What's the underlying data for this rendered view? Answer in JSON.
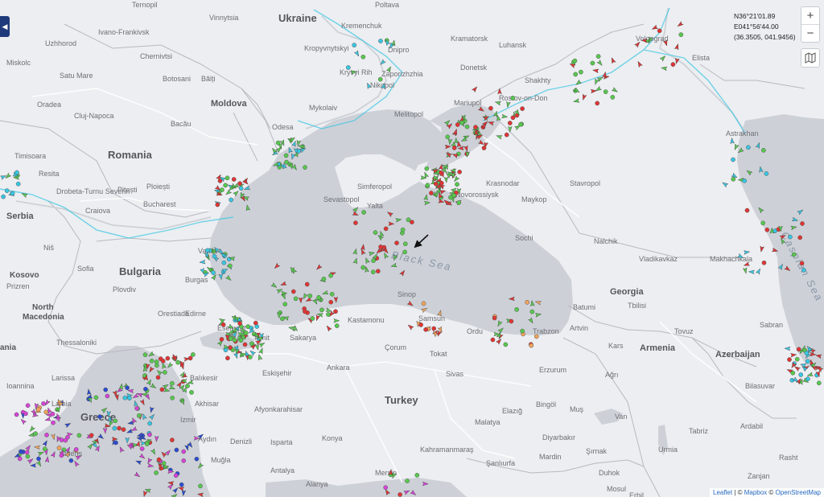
{
  "coords": {
    "lat": "N36°21'01.89",
    "lon": "E041°56'44.00",
    "decimal": "(36.3505, 041.9456)"
  },
  "controls": {
    "zoom_in": "+",
    "zoom_out": "−",
    "sidebar_toggle": "◀"
  },
  "attribution": {
    "leaflet": "Leaflet",
    "separator": " | © ",
    "mapbox": "Mapbox",
    "osm": "OpenStreetMap"
  },
  "labels": {
    "countries": [
      {
        "text": "Ukraine"
      },
      {
        "text": "Romania"
      },
      {
        "text": "Moldova"
      },
      {
        "text": "Serbia"
      },
      {
        "text": "Bulgaria"
      },
      {
        "text": "Kosovo"
      },
      {
        "text": "North"
      },
      {
        "text": "Macedonia"
      },
      {
        "text": "Greece"
      },
      {
        "text": "Turkey"
      },
      {
        "text": "Georgia"
      },
      {
        "text": "Armenia"
      },
      {
        "text": "Azerbaijan"
      },
      {
        "text": "ania"
      }
    ],
    "seas": [
      {
        "text": "Black Sea"
      },
      {
        "text": "Caspian Sea"
      }
    ],
    "cities": [
      {
        "text": "Ternopil"
      },
      {
        "text": "Vinnytsia"
      },
      {
        "text": "Poltava"
      },
      {
        "text": "Kremenchuk"
      },
      {
        "text": "Uzhhorod"
      },
      {
        "text": "Ivano-Frankivsk"
      },
      {
        "text": "Kramatorsk"
      },
      {
        "text": "Luhansk"
      },
      {
        "text": "Kropyvnytskyi"
      },
      {
        "text": "Dnipro"
      },
      {
        "text": "Volgograd"
      },
      {
        "text": "Miskolc"
      },
      {
        "text": "Chernivtsi"
      },
      {
        "text": "Kryvyi Rih"
      },
      {
        "text": "Zaporizhzhia"
      },
      {
        "text": "Donetsk"
      },
      {
        "text": "Elista"
      },
      {
        "text": "Satu Mare"
      },
      {
        "text": "Botosani"
      },
      {
        "text": "Bălți"
      },
      {
        "text": "Nikopol"
      },
      {
        "text": "Shakhty"
      },
      {
        "text": "Oradea"
      },
      {
        "text": "Cluj-Napoca"
      },
      {
        "text": "Mykolaiv"
      },
      {
        "text": "Mariupol"
      },
      {
        "text": "Rostov-on-Don"
      },
      {
        "text": "Melitopol"
      },
      {
        "text": "Bacău"
      },
      {
        "text": "Odesa"
      },
      {
        "text": "Astrakhan"
      },
      {
        "text": "Timisoara"
      },
      {
        "text": "Resita"
      },
      {
        "text": "Simferopol"
      },
      {
        "text": "Krasnodar"
      },
      {
        "text": "Stavropol"
      },
      {
        "text": "Drobeta-Turnu Severin"
      },
      {
        "text": "Pitești"
      },
      {
        "text": "Ploiești"
      },
      {
        "text": "Sevastopol"
      },
      {
        "text": "Yalta"
      },
      {
        "text": "Novorossiysk"
      },
      {
        "text": "Maykop"
      },
      {
        "text": "Craiova"
      },
      {
        "text": "Bucharest"
      },
      {
        "text": "Sochi"
      },
      {
        "text": "Niš"
      },
      {
        "text": "Nalchik"
      },
      {
        "text": "Varna"
      },
      {
        "text": "Vladikavkaz"
      },
      {
        "text": "Makhachkala"
      },
      {
        "text": "Sofia"
      },
      {
        "text": "Burgas"
      },
      {
        "text": "Prizren"
      },
      {
        "text": "Plovdiv"
      },
      {
        "text": "Tbilisi"
      },
      {
        "text": "Batumi"
      },
      {
        "text": "Sinop"
      },
      {
        "text": "Kastamonu"
      },
      {
        "text": "Samsun"
      },
      {
        "text": "Ordu"
      },
      {
        "text": "Trabzon"
      },
      {
        "text": "Artvin"
      },
      {
        "text": "Edirne"
      },
      {
        "text": "Tovuz"
      },
      {
        "text": "Sabran"
      },
      {
        "text": "Thessaloniki"
      },
      {
        "text": "Esenyurt"
      },
      {
        "text": "Izmit"
      },
      {
        "text": "Sakarya"
      },
      {
        "text": "Çorum"
      },
      {
        "text": "Tokat"
      },
      {
        "text": "Kars"
      },
      {
        "text": "Erzurum"
      },
      {
        "text": "Larissa"
      },
      {
        "text": "Balıkesir"
      },
      {
        "text": "Eskişehir"
      },
      {
        "text": "Ankara"
      },
      {
        "text": "Sivas"
      },
      {
        "text": "Ağrı"
      },
      {
        "text": "Akhisar"
      },
      {
        "text": "Afyonkarahisar"
      },
      {
        "text": "Bingöl"
      },
      {
        "text": "Muş"
      },
      {
        "text": "Izmir"
      },
      {
        "text": "Elazığ"
      },
      {
        "text": "Van"
      },
      {
        "text": "Aydın"
      },
      {
        "text": "Denizli"
      },
      {
        "text": "Isparta"
      },
      {
        "text": "Konya"
      },
      {
        "text": "Malatya"
      },
      {
        "text": "Diyarbakır"
      },
      {
        "text": "Tabriz"
      },
      {
        "text": "Muğla"
      },
      {
        "text": "Kahramanmaraş"
      },
      {
        "text": "Şanlıurfa"
      },
      {
        "text": "Mardin"
      },
      {
        "text": "Şırnak"
      },
      {
        "text": "Urmia"
      },
      {
        "text": "Antalya"
      },
      {
        "text": "Mersin"
      },
      {
        "text": "Alanya"
      },
      {
        "text": "Duhok"
      },
      {
        "text": "Mosul"
      },
      {
        "text": "Erbil"
      },
      {
        "text": "Zanjan"
      },
      {
        "text": "Rasht"
      },
      {
        "text": "Ardabil"
      },
      {
        "text": "Bilasuvar"
      },
      {
        "text": "Orestiada"
      },
      {
        "text": "Lamia"
      },
      {
        "text": "Athens"
      },
      {
        "text": "Ioannina"
      }
    ]
  },
  "colors": {
    "land": "#eceef1",
    "water": "#cdd1d7",
    "border": "#a9adb3",
    "cargo": "#57c84d",
    "tanker": "#e13434",
    "passenger": "#d743d7",
    "tug": "#39c6e3",
    "fishing": "#f1a35b",
    "highspeed": "#2b4bd4",
    "unknown": "#9aa0a6"
  }
}
